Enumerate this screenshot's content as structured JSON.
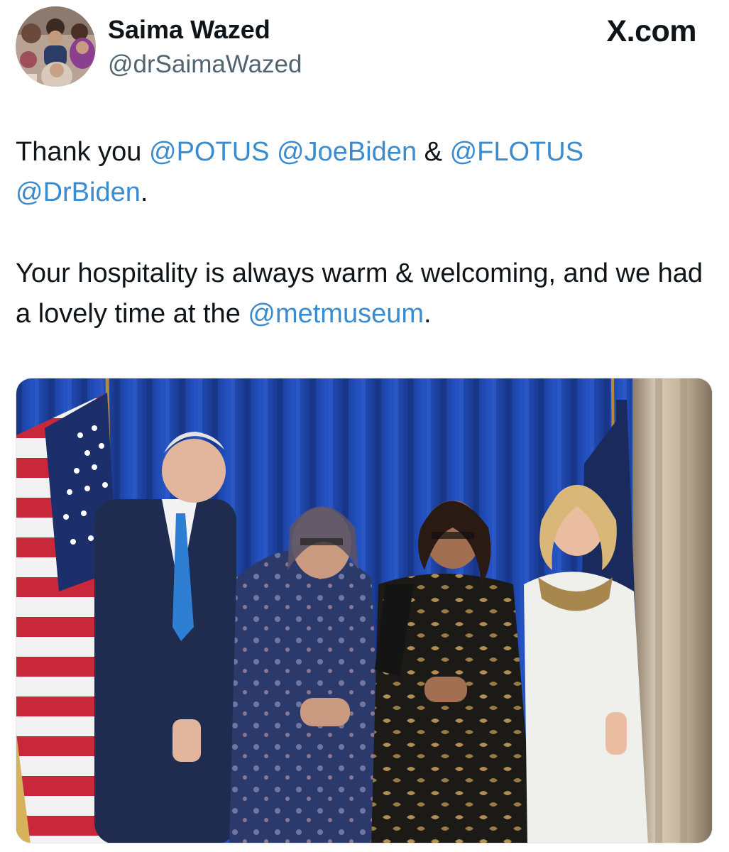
{
  "author": {
    "display_name": "Saima Wazed",
    "handle": "@drSaimaWazed"
  },
  "brand": {
    "label": "X.com"
  },
  "tweet": {
    "para1": {
      "t1": "Thank you ",
      "m1": "@POTUS",
      "t2": " ",
      "m2": "@JoeBiden",
      "t3": " & ",
      "m3": "@FLOTUS",
      "t4": " ",
      "m4": "@DrBiden",
      "t5": "."
    },
    "para2": {
      "t1": "Your hospitality is always warm & welcoming, and we had a lovely time at the ",
      "m1": "@metmuseum",
      "t2": "."
    }
  },
  "colors": {
    "text": "#0f1419",
    "secondary_text": "#536471",
    "link": "#3a8ccf",
    "curtain": "#1d3f9e"
  },
  "icons": {
    "avatar": "profile-photo-group",
    "media": "event-photo"
  }
}
